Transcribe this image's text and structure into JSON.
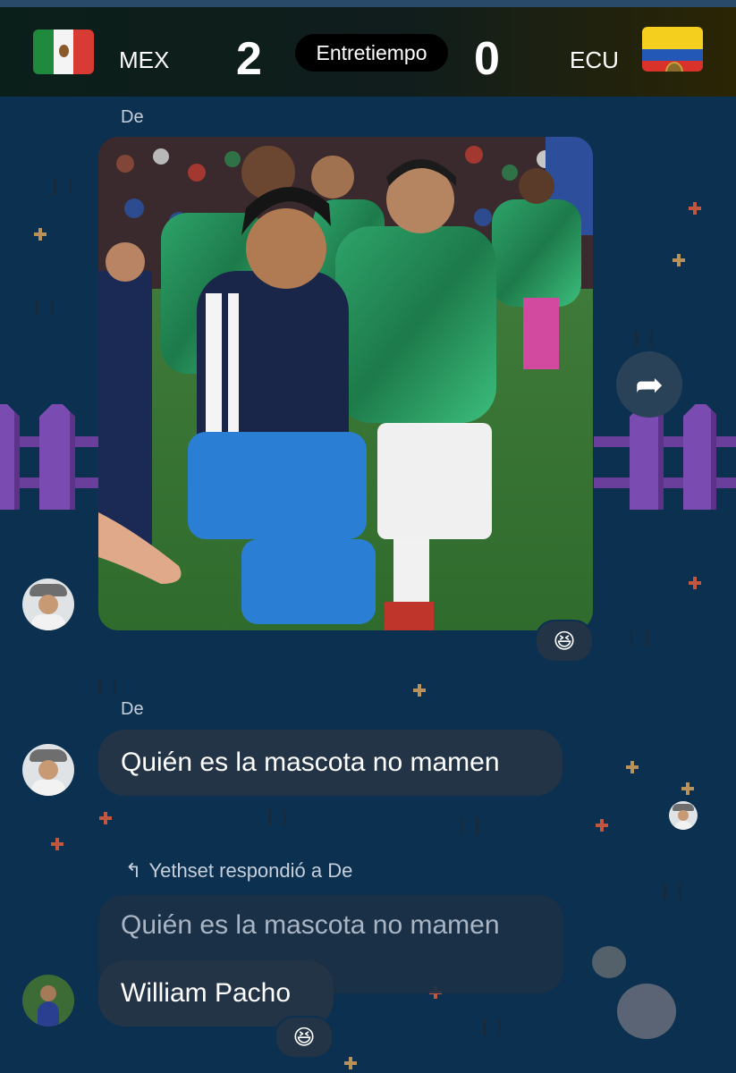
{
  "match": {
    "home_team": "MEX",
    "away_team": "ECU",
    "home_score": "2",
    "away_score": "0",
    "status": "Entretiempo",
    "home_flag": "mexico-flag",
    "away_flag": "ecuador-flag"
  },
  "messages": [
    {
      "sender": "De",
      "type": "image",
      "image_desc": "photo",
      "reaction": "😆"
    },
    {
      "sender": "De",
      "type": "text",
      "text": "Quién es la mascota no mamen"
    },
    {
      "type": "reply",
      "reply_label": "Yethset respondió a De",
      "quoted_text": "Quién es la mascota no mamen",
      "text": "William Pacho",
      "reaction": "😆"
    }
  ],
  "colors": {
    "background": "#0c3050",
    "bubble": "#243447",
    "fence": "#7a4bb0"
  }
}
